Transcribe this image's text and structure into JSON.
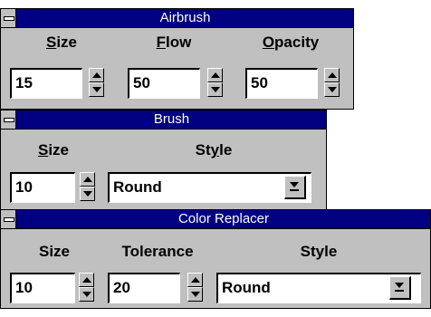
{
  "airbrush": {
    "title": "Airbrush",
    "size_label": "Size",
    "size_value": "15",
    "flow_label": "Flow",
    "flow_value": "50",
    "opacity_label": "Opacity",
    "opacity_value": "50"
  },
  "brush": {
    "title": "Brush",
    "size_label": "Size",
    "size_value": "10",
    "style_label": "Style",
    "style_value": "Round"
  },
  "color_replacer": {
    "title": "Color Replacer",
    "size_label": "Size",
    "size_value": "10",
    "tolerance_label": "Tolerance",
    "tolerance_value": "20",
    "style_label": "Style",
    "style_value": "Round"
  },
  "colors": {
    "titlebar": "#000080",
    "panel": "#c0c0c0",
    "title_text": "#ffffff"
  },
  "icons": {
    "window_menu": "system-menu-icon",
    "spin_up": "up-arrow-icon",
    "spin_down": "down-arrow-icon",
    "dropdown": "dropdown-arrow-icon"
  }
}
